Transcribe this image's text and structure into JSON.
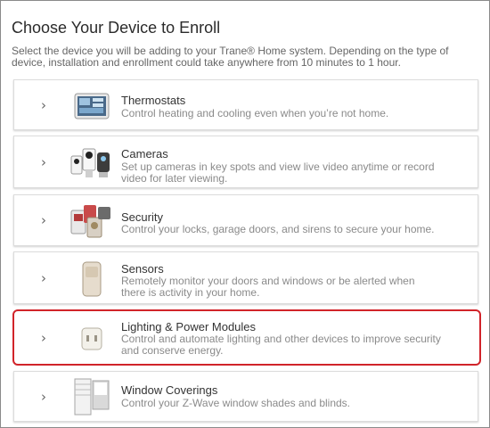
{
  "page": {
    "title": "Choose Your Device to Enroll",
    "intro": "Select the device you will be adding to your Trane® Home system. Depending on the type of device, installation and enrollment could take anywhere from 10 minutes to 1 hour."
  },
  "devices": [
    {
      "title": "Thermostats",
      "description": "Control heating and cooling even when you’re not home.",
      "icon": "thermostat-icon"
    },
    {
      "title": "Cameras",
      "description": "Set up cameras in key spots and view live video anytime or record video for later viewing.",
      "icon": "camera-icon"
    },
    {
      "title": "Security",
      "description": "Control your locks, garage doors, and sirens to secure your home.",
      "icon": "security-icon"
    },
    {
      "title": "Sensors",
      "description": "Remotely monitor your doors and windows or be alerted when there is activity in your home.",
      "icon": "sensor-icon"
    },
    {
      "title": "Lighting & Power Modules",
      "description": "Control and automate lighting and other devices to improve security and conserve energy.",
      "icon": "power-module-icon",
      "selected": true
    },
    {
      "title": "Window Coverings",
      "description": "Control your Z-Wave window shades and blinds.",
      "icon": "window-covering-icon"
    }
  ],
  "chevron": "›",
  "colors": {
    "highlight": "#d1242a",
    "text": "#333333",
    "muted": "#8a8a8a"
  }
}
